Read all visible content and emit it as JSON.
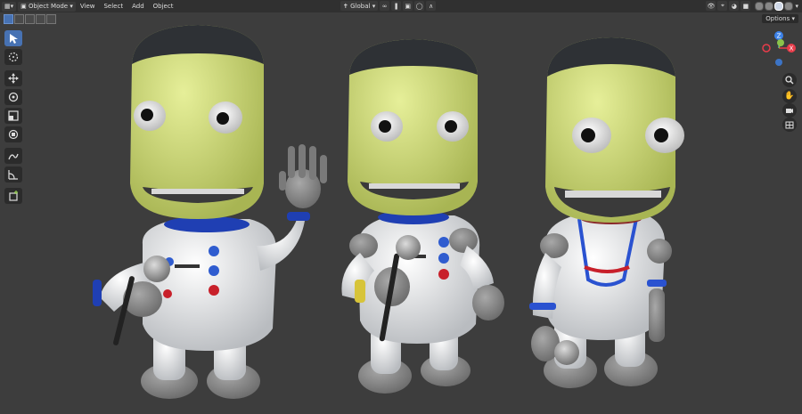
{
  "header": {
    "editor_type_icon": "viewport-icon",
    "mode_label": "Object Mode",
    "menus": [
      "View",
      "Select",
      "Add",
      "Object"
    ],
    "transform_orientation": "Global"
  },
  "subbar": {
    "options_label": "Options"
  },
  "gizmo": {
    "z_label": "Z",
    "x_label": "X",
    "y_label": "Y"
  },
  "colors": {
    "accent": "#4772b3",
    "header_bg": "#303030",
    "viewport_bg": "#3d3d3d",
    "axis_x": "#e83c4a",
    "axis_y": "#8bc34a",
    "axis_z": "#3c82e8"
  }
}
